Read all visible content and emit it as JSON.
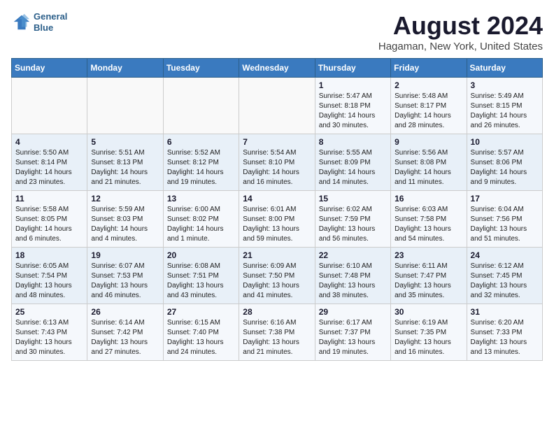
{
  "header": {
    "logo_line1": "General",
    "logo_line2": "Blue",
    "main_title": "August 2024",
    "subtitle": "Hagaman, New York, United States"
  },
  "weekdays": [
    "Sunday",
    "Monday",
    "Tuesday",
    "Wednesday",
    "Thursday",
    "Friday",
    "Saturday"
  ],
  "weeks": [
    [
      {
        "day": "",
        "content": ""
      },
      {
        "day": "",
        "content": ""
      },
      {
        "day": "",
        "content": ""
      },
      {
        "day": "",
        "content": ""
      },
      {
        "day": "1",
        "content": "Sunrise: 5:47 AM\nSunset: 8:18 PM\nDaylight: 14 hours\nand 30 minutes."
      },
      {
        "day": "2",
        "content": "Sunrise: 5:48 AM\nSunset: 8:17 PM\nDaylight: 14 hours\nand 28 minutes."
      },
      {
        "day": "3",
        "content": "Sunrise: 5:49 AM\nSunset: 8:15 PM\nDaylight: 14 hours\nand 26 minutes."
      }
    ],
    [
      {
        "day": "4",
        "content": "Sunrise: 5:50 AM\nSunset: 8:14 PM\nDaylight: 14 hours\nand 23 minutes."
      },
      {
        "day": "5",
        "content": "Sunrise: 5:51 AM\nSunset: 8:13 PM\nDaylight: 14 hours\nand 21 minutes."
      },
      {
        "day": "6",
        "content": "Sunrise: 5:52 AM\nSunset: 8:12 PM\nDaylight: 14 hours\nand 19 minutes."
      },
      {
        "day": "7",
        "content": "Sunrise: 5:54 AM\nSunset: 8:10 PM\nDaylight: 14 hours\nand 16 minutes."
      },
      {
        "day": "8",
        "content": "Sunrise: 5:55 AM\nSunset: 8:09 PM\nDaylight: 14 hours\nand 14 minutes."
      },
      {
        "day": "9",
        "content": "Sunrise: 5:56 AM\nSunset: 8:08 PM\nDaylight: 14 hours\nand 11 minutes."
      },
      {
        "day": "10",
        "content": "Sunrise: 5:57 AM\nSunset: 8:06 PM\nDaylight: 14 hours\nand 9 minutes."
      }
    ],
    [
      {
        "day": "11",
        "content": "Sunrise: 5:58 AM\nSunset: 8:05 PM\nDaylight: 14 hours\nand 6 minutes."
      },
      {
        "day": "12",
        "content": "Sunrise: 5:59 AM\nSunset: 8:03 PM\nDaylight: 14 hours\nand 4 minutes."
      },
      {
        "day": "13",
        "content": "Sunrise: 6:00 AM\nSunset: 8:02 PM\nDaylight: 14 hours\nand 1 minute."
      },
      {
        "day": "14",
        "content": "Sunrise: 6:01 AM\nSunset: 8:00 PM\nDaylight: 13 hours\nand 59 minutes."
      },
      {
        "day": "15",
        "content": "Sunrise: 6:02 AM\nSunset: 7:59 PM\nDaylight: 13 hours\nand 56 minutes."
      },
      {
        "day": "16",
        "content": "Sunrise: 6:03 AM\nSunset: 7:58 PM\nDaylight: 13 hours\nand 54 minutes."
      },
      {
        "day": "17",
        "content": "Sunrise: 6:04 AM\nSunset: 7:56 PM\nDaylight: 13 hours\nand 51 minutes."
      }
    ],
    [
      {
        "day": "18",
        "content": "Sunrise: 6:05 AM\nSunset: 7:54 PM\nDaylight: 13 hours\nand 48 minutes."
      },
      {
        "day": "19",
        "content": "Sunrise: 6:07 AM\nSunset: 7:53 PM\nDaylight: 13 hours\nand 46 minutes."
      },
      {
        "day": "20",
        "content": "Sunrise: 6:08 AM\nSunset: 7:51 PM\nDaylight: 13 hours\nand 43 minutes."
      },
      {
        "day": "21",
        "content": "Sunrise: 6:09 AM\nSunset: 7:50 PM\nDaylight: 13 hours\nand 41 minutes."
      },
      {
        "day": "22",
        "content": "Sunrise: 6:10 AM\nSunset: 7:48 PM\nDaylight: 13 hours\nand 38 minutes."
      },
      {
        "day": "23",
        "content": "Sunrise: 6:11 AM\nSunset: 7:47 PM\nDaylight: 13 hours\nand 35 minutes."
      },
      {
        "day": "24",
        "content": "Sunrise: 6:12 AM\nSunset: 7:45 PM\nDaylight: 13 hours\nand 32 minutes."
      }
    ],
    [
      {
        "day": "25",
        "content": "Sunrise: 6:13 AM\nSunset: 7:43 PM\nDaylight: 13 hours\nand 30 minutes."
      },
      {
        "day": "26",
        "content": "Sunrise: 6:14 AM\nSunset: 7:42 PM\nDaylight: 13 hours\nand 27 minutes."
      },
      {
        "day": "27",
        "content": "Sunrise: 6:15 AM\nSunset: 7:40 PM\nDaylight: 13 hours\nand 24 minutes."
      },
      {
        "day": "28",
        "content": "Sunrise: 6:16 AM\nSunset: 7:38 PM\nDaylight: 13 hours\nand 21 minutes."
      },
      {
        "day": "29",
        "content": "Sunrise: 6:17 AM\nSunset: 7:37 PM\nDaylight: 13 hours\nand 19 minutes."
      },
      {
        "day": "30",
        "content": "Sunrise: 6:19 AM\nSunset: 7:35 PM\nDaylight: 13 hours\nand 16 minutes."
      },
      {
        "day": "31",
        "content": "Sunrise: 6:20 AM\nSunset: 7:33 PM\nDaylight: 13 hours\nand 13 minutes."
      }
    ]
  ]
}
